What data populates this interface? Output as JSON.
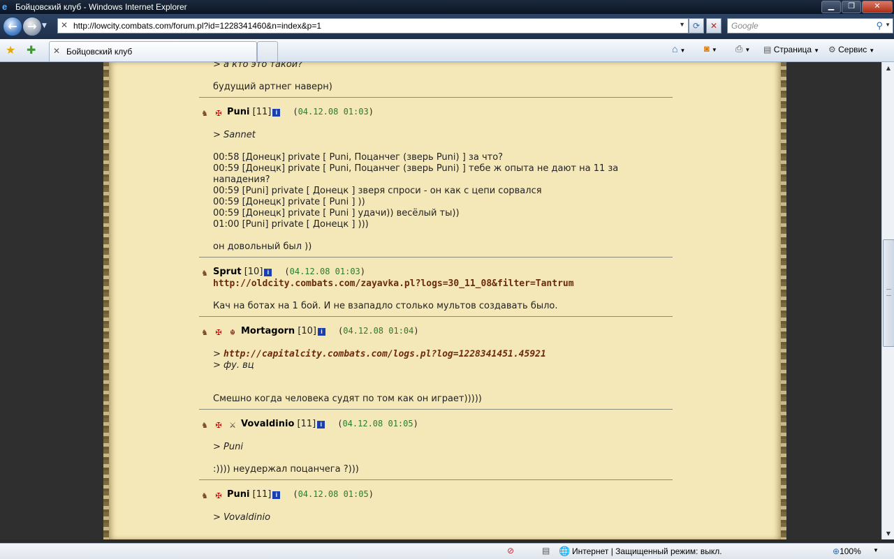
{
  "window": {
    "title": "Бойцовский клуб - Windows Internet Explorer",
    "controls": {
      "minimize": "▁",
      "maximize": "❐",
      "close": "✕"
    }
  },
  "address_bar": {
    "url": "http://lowcity.combats.com/forum.pl?id=1228341460&n=index&p=1",
    "search_placeholder": "Google"
  },
  "tabs": [
    {
      "label": "Бойцовский клуб"
    }
  ],
  "command_bar": {
    "page_label": "Страница",
    "tools_label": "Сервис"
  },
  "posts": [
    {
      "partial_top": true,
      "lines": [
        {
          "type": "quote",
          "text": "> а кто это такой?"
        },
        {
          "type": "gap"
        },
        {
          "type": "text",
          "text": "будущий артнег наверн)"
        }
      ]
    },
    {
      "author": "Puni",
      "level": "[11]",
      "date": "04.12.08 01:03",
      "badges": [
        "align-icon",
        "klan-icon"
      ],
      "lines": [
        {
          "type": "gap"
        },
        {
          "type": "quote",
          "text": "> Sannet"
        },
        {
          "type": "gap"
        },
        {
          "type": "text",
          "text": "00:58 [Донецк] private [ Puni, Поцанчег (зверь Puni) ] за что?"
        },
        {
          "type": "text",
          "text": "00:59 [Донецк] private [ Puni, Поцанчег (зверь Puni) ] тебе ж опыта не дают на 11 за"
        },
        {
          "type": "text",
          "text": "нападения?"
        },
        {
          "type": "text",
          "text": "00:59 [Puni] private [ Донецк ] зверя спроси - он как с цепи сорвался"
        },
        {
          "type": "text",
          "text": "00:59 [Донецк] private [ Puni ] ))"
        },
        {
          "type": "text",
          "text": "00:59 [Донецк] private [ Puni ] удачи)) весёлый ты))"
        },
        {
          "type": "text",
          "text": "01:00 [Puni] private [ Донецк ] )))"
        },
        {
          "type": "gap"
        },
        {
          "type": "text",
          "text": "он довольный был ))"
        }
      ]
    },
    {
      "author": "Sprut",
      "level": "[10]",
      "date": "04.12.08 01:03",
      "badges": [
        "align-icon"
      ],
      "lines": [
        {
          "type": "link",
          "text": "http://oldcity.combats.com/zayavka.pl?logs=30_11_08&filter=Tantrum"
        },
        {
          "type": "gap"
        },
        {
          "type": "text",
          "text": "Кач на ботах на 1 бой. И не взападло столько мультов создавать было."
        }
      ]
    },
    {
      "author": "Mortagorn",
      "level": "[10]",
      "date": "04.12.08 01:04",
      "badges": [
        "align-icon",
        "klan-icon",
        "demon-icon"
      ],
      "lines": [
        {
          "type": "gap"
        },
        {
          "type": "qlink",
          "prefix": "> ",
          "text": "http://capitalcity.combats.com/logs.pl?log=1228341451.45921"
        },
        {
          "type": "quote",
          "text": "> фу. вц"
        },
        {
          "type": "gap"
        },
        {
          "type": "gap"
        },
        {
          "type": "text",
          "text": "Смешно когда человека судят по том как он играет)))))"
        }
      ]
    },
    {
      "author": "Vovaldinio",
      "level": "[11]",
      "date": "04.12.08 01:05",
      "badges": [
        "align-icon",
        "klan-icon",
        "rank-icon"
      ],
      "lines": [
        {
          "type": "gap"
        },
        {
          "type": "quote",
          "text": "> Puni"
        },
        {
          "type": "gap"
        },
        {
          "type": "text",
          "text": ":)))) неудержал поцанчега ?)))"
        }
      ]
    },
    {
      "author": "Puni",
      "level": "[11]",
      "date": "04.12.08 01:05",
      "badges": [
        "align-icon",
        "klan-icon"
      ],
      "lines": [
        {
          "type": "gap"
        },
        {
          "type": "quote",
          "text": "> Vovaldinio"
        }
      ]
    }
  ],
  "status_bar": {
    "zone": "Интернет | Защищенный режим: выкл.",
    "zoom": "100%"
  },
  "colors": {
    "parchment": "#f5e8b8",
    "date": "#2a7a2a",
    "link": "#6b2a0a",
    "info_badge": "#1a3fb0"
  }
}
